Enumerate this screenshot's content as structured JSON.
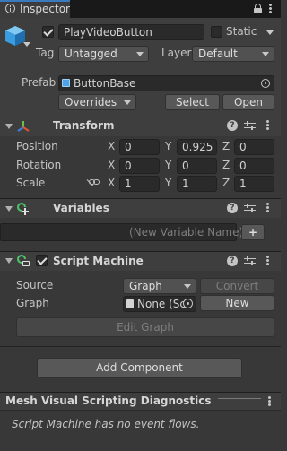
{
  "tab": {
    "title": "Inspector"
  },
  "header": {
    "object_name": "PlayVideoButton",
    "static_label": "Static",
    "tag_label": "Tag",
    "tag_value": "Untagged",
    "layer_label": "Layer",
    "layer_value": "Default",
    "prefab_label": "Prefab",
    "prefab_value": "ButtonBase",
    "overrides_label": "Overrides",
    "select_label": "Select",
    "open_label": "Open"
  },
  "transform": {
    "title": "Transform",
    "rows": [
      {
        "label": "Position",
        "x": "0",
        "y": "0.925",
        "z": "0"
      },
      {
        "label": "Rotation",
        "x": "0",
        "y": "0",
        "z": "0"
      },
      {
        "label": "Scale",
        "x": "1",
        "y": "1",
        "z": "1"
      }
    ],
    "axis": {
      "x": "X",
      "y": "Y",
      "z": "Z"
    }
  },
  "variables": {
    "title": "Variables",
    "placeholder": "(New Variable Name)",
    "add_label": "+"
  },
  "script_machine": {
    "title": "Script Machine",
    "source_label": "Source",
    "source_value": "Graph",
    "convert_label": "Convert",
    "graph_label": "Graph",
    "graph_value": "None (Sc",
    "new_label": "New",
    "edit_graph_label": "Edit Graph"
  },
  "add_component_label": "Add Component",
  "diagnostics": {
    "title": "Mesh Visual Scripting Diagnostics",
    "message": "Script Machine has no event flows."
  },
  "icons": [
    "info-icon",
    "lock-icon",
    "menu-icon",
    "cube-icon",
    "help-icon",
    "settings-icon",
    "more-icon",
    "transform-icon",
    "variables-icon",
    "script-machine-icon",
    "link-icon",
    "prefab-icon",
    "target-icon"
  ],
  "colors": {
    "accent": "#3a79bb",
    "background": "#383838",
    "header": "#3e3e3e"
  }
}
